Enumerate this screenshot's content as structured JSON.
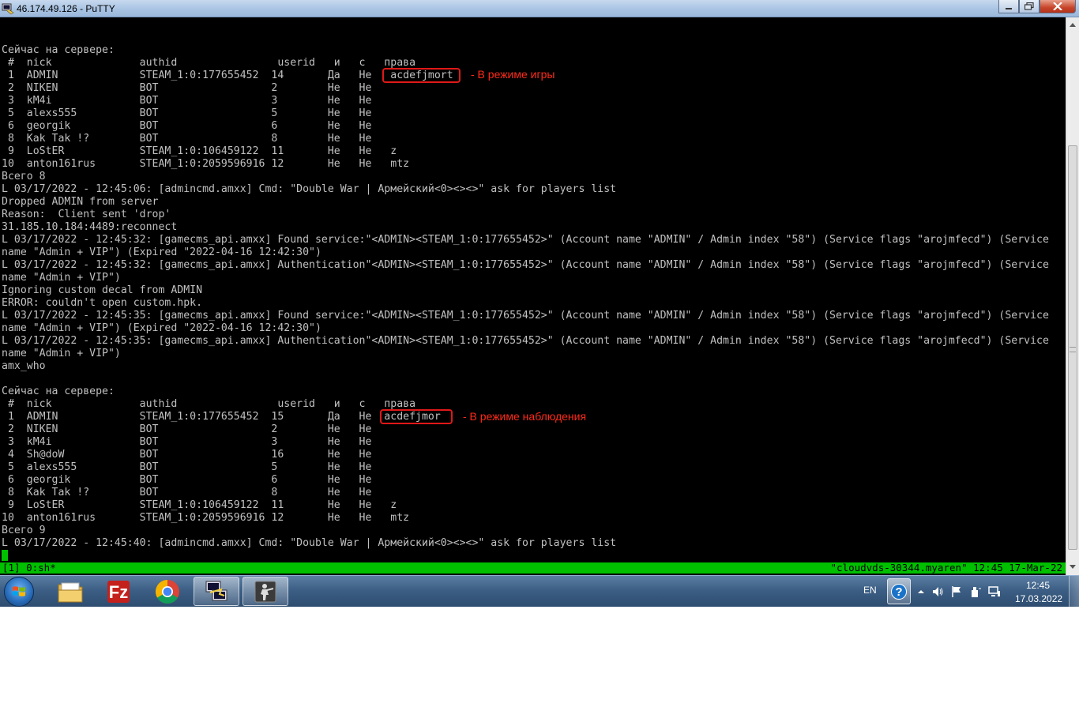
{
  "window": {
    "title": "46.174.49.126 - PuTTY"
  },
  "terminal": {
    "lines": [
      "",
      "",
      "Сейчас на сервере:",
      " #  nick              authid                userid   и   с   права",
      " 1  ADMIN             STEAM_1:0:177655452  14       Да   Не   acdefjmort",
      " 2  NIKEN             BOT                  2        Не   Не",
      " 3  kM4i              BOT                  3        Не   Не",
      " 5  alexs555          BOT                  5        Не   Не",
      " 6  georgik           BOT                  6        Не   Не",
      " 8  Kak Tak !?        BOT                  8        Не   Не",
      " 9  LoStER            STEAM_1:0:106459122  11       Не   Не   z",
      "10  anton161rus       STEAM_1:0:2059596916 12       Не   Не   mtz",
      "Всего 8",
      "L 03/17/2022 - 12:45:06: [admincmd.amxx] Cmd: \"Double War | Армейский<0><><>\" ask for players list",
      "Dropped ADMIN from server",
      "Reason:  Client sent 'drop'",
      "31.185.10.184:4489:reconnect",
      "L 03/17/2022 - 12:45:32: [gamecms_api.amxx] Found service:\"<ADMIN><STEAM_1:0:177655452>\" (Account name \"ADMIN\" / Admin index \"58\") (Service flags \"arojmfecd\") (Service",
      "name \"Admin + VIP\") (Expired \"2022-04-16 12:42:30\")",
      "L 03/17/2022 - 12:45:32: [gamecms_api.amxx] Authentication\"<ADMIN><STEAM_1:0:177655452>\" (Account name \"ADMIN\" / Admin index \"58\") (Service flags \"arojmfecd\") (Service",
      "name \"Admin + VIP\")",
      "Ignoring custom decal from ADMIN",
      "ERROR: couldn't open custom.hpk.",
      "L 03/17/2022 - 12:45:35: [gamecms_api.amxx] Found service:\"<ADMIN><STEAM_1:0:177655452>\" (Account name \"ADMIN\" / Admin index \"58\") (Service flags \"arojmfecd\") (Service",
      "name \"Admin + VIP\") (Expired \"2022-04-16 12:42:30\")",
      "L 03/17/2022 - 12:45:35: [gamecms_api.amxx] Authentication\"<ADMIN><STEAM_1:0:177655452>\" (Account name \"ADMIN\" / Admin index \"58\") (Service flags \"arojmfecd\") (Service",
      "name \"Admin + VIP\")",
      "amx_who",
      "",
      "Сейчас на сервере:",
      " #  nick              authid                userid   и   с   права",
      " 1  ADMIN             STEAM_1:0:177655452  15       Да   Не  acdefjmor",
      " 2  NIKEN             BOT                  2        Не   Не",
      " 3  kM4i              BOT                  3        Не   Не",
      " 4  Sh@doW            BOT                  16       Не   Не",
      " 5  alexs555          BOT                  5        Не   Не",
      " 6  georgik           BOT                  6        Не   Не",
      " 8  Kak Tak !?        BOT                  8        Не   Не",
      " 9  LoStER            STEAM_1:0:106459122  11       Не   Не   z",
      "10  anton161rus       STEAM_1:0:2059596916 12       Не   Не   mtz",
      "Всего 9",
      "L 03/17/2022 - 12:45:40: [admincmd.amxx] Cmd: \"Double War | Армейский<0><><>\" ask for players list"
    ],
    "status_left": "[1] 0:sh*",
    "status_right": "\"cloudvds-30344.myaren\" 12:45 17-Mar-22"
  },
  "annotations": {
    "playing": "- В режиме игры",
    "spectating": "- В режиме наблюдения",
    "color": "#e01818"
  },
  "taskbar": {
    "language": "EN",
    "time": "12:45",
    "date": "17.03.2022",
    "apps": [
      "windows-explorer",
      "filezilla",
      "chrome",
      "putty",
      "counter-strike"
    ]
  },
  "colors": {
    "terminal_bg": "#000000",
    "terminal_fg": "#c0c0c0",
    "status_bar": "#00c000"
  }
}
